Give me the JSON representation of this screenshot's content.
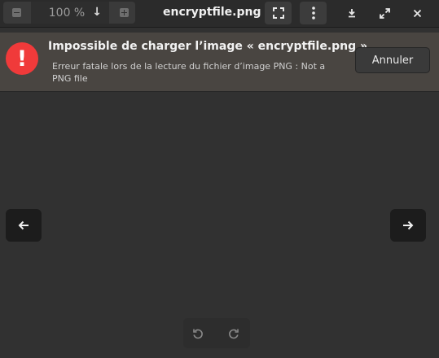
{
  "header": {
    "zoom_level": "100 %",
    "title": "encryptfile.png"
  },
  "infobar": {
    "title": "Impossible de charger l’image « encryptfile.png ».",
    "message": "Erreur fatale lors de la lecture du fichier d’image PNG : Not a PNG file",
    "cancel_label": "Annuler"
  },
  "colors": {
    "error": "#f03a3a",
    "infobar_bg": "#494541",
    "canvas_bg": "#313131"
  }
}
